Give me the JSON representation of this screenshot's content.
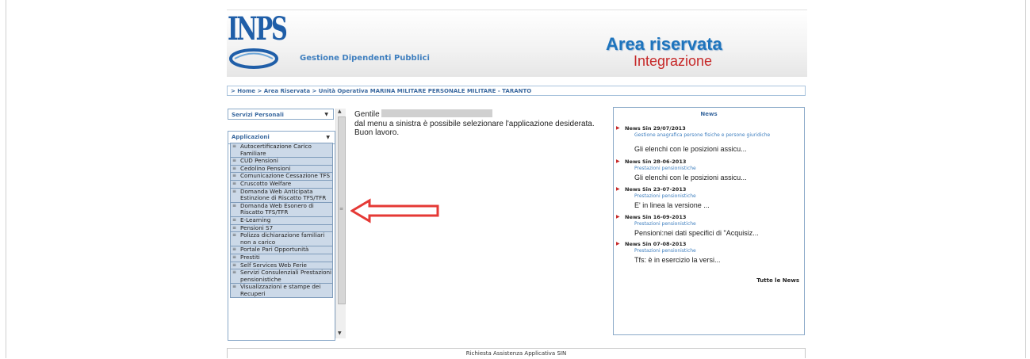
{
  "header": {
    "logo_text": "INPS",
    "subtitle": "Gestione Dipendenti Pubblici",
    "area_title": "Area riservata",
    "area_subtitle": "Integrazione"
  },
  "breadcrumb": "> Home > Area Riservata > Unità Operativa MARINA MILITARE PERSONALE MILITARE - TARANTO",
  "sidebar": {
    "servizi_label": "Servizi Personali",
    "applicazioni_label": "Applicazioni",
    "items": [
      {
        "label": "Autocertificazione Carico Familiare"
      },
      {
        "label": "CUD Pensioni"
      },
      {
        "label": "Cedolino Pensioni"
      },
      {
        "label": "Comunicazione Cessazione TFS"
      },
      {
        "label": "Cruscotto Welfare"
      },
      {
        "label": "Domanda Web Anticipata Estinzione di Riscatto TFS/TFR"
      },
      {
        "label": "Domanda Web Esonero di Riscatto TFS/TFR"
      },
      {
        "label": "E-Learning"
      },
      {
        "label": "Pensioni S7"
      },
      {
        "label": "Polizza dichiarazione familiari non a carico"
      },
      {
        "label": "Portale Pari Opportunità"
      },
      {
        "label": "Prestiti"
      },
      {
        "label": "Self Services Web Ferie"
      },
      {
        "label": "Servizi Consulenziali Prestazioni pensionistiche"
      },
      {
        "label": "Visualizzazioni e stampe dei Recuperi"
      }
    ]
  },
  "main": {
    "greeting": "Gentile",
    "line1": "dal menu a sinistra è possibile selezionare l'applicazione desiderata.",
    "line2": "Buon lavoro."
  },
  "news": {
    "title": "News",
    "items": [
      {
        "date": "News Sin 29/07/2013",
        "category": "Gestione anagrafica persone fisiche e persone giuridiche",
        "text": "Gli elenchi con le posizioni assicu..."
      },
      {
        "date": "News Sin 28-06-2013",
        "category": "Prestazioni pensionistiche",
        "text": "Gli elenchi con le posizioni assicu..."
      },
      {
        "date": "News Sin 23-07-2013",
        "category": "Prestazioni pensionistiche",
        "text": "E' in linea la versione  ..."
      },
      {
        "date": "News Sin 16-09-2013",
        "category": "Prestazioni pensionistiche",
        "text": "Pensioni:nei dati specifici di \"Acquisiz..."
      },
      {
        "date": "News Sin 07-08-2013",
        "category": "Prestazioni pensionistiche",
        "text": "Tfs: è in esercizio la versi..."
      }
    ],
    "all_link": "Tutte le News"
  },
  "footer": "Richiesta Assistenza Applicativa SIN",
  "colors": {
    "brand_blue": "#1e74bd",
    "accent_red": "#c62828",
    "menu_bg": "#ccd9e8"
  }
}
